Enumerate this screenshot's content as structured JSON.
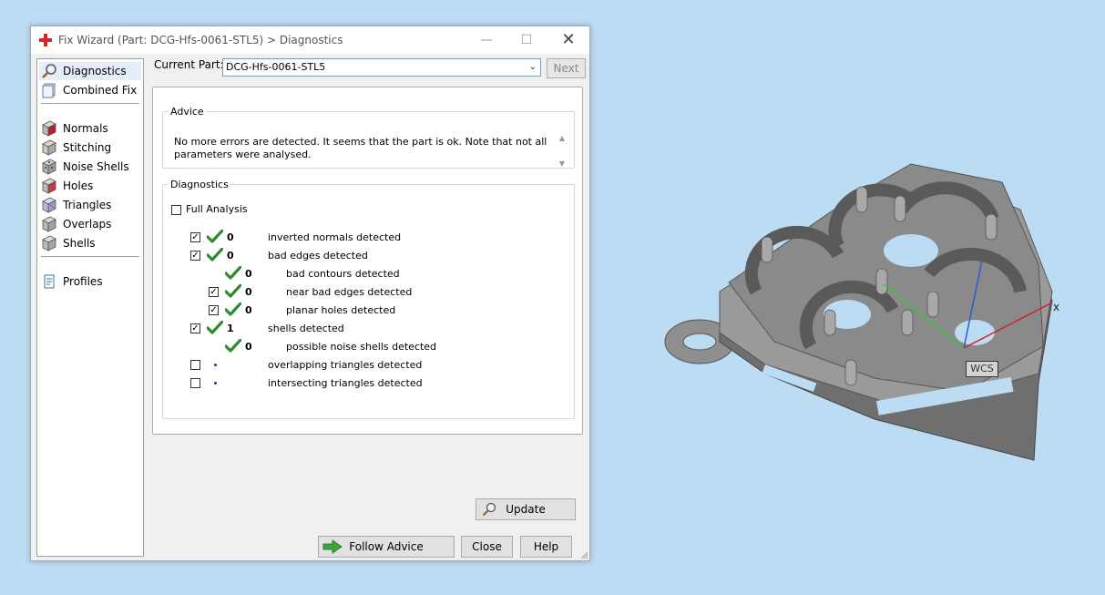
{
  "window": {
    "title": "Fix Wizard (Part: DCG-Hfs-0061-STL5) > Diagnostics",
    "minimize": "—",
    "maximize": "☐",
    "close": "✕"
  },
  "nav": {
    "items": [
      {
        "label": "Diagnostics",
        "icon": "magnifier-icon"
      },
      {
        "label": "Combined Fix",
        "icon": "combined-fix-icon"
      },
      {
        "label": "Normals",
        "icon": "normals-cube-icon"
      },
      {
        "label": "Stitching",
        "icon": "stitching-cube-icon"
      },
      {
        "label": "Noise Shells",
        "icon": "noise-shells-cube-icon"
      },
      {
        "label": "Holes",
        "icon": "holes-cube-icon"
      },
      {
        "label": "Triangles",
        "icon": "triangles-cube-icon"
      },
      {
        "label": "Overlaps",
        "icon": "overlaps-cube-icon"
      },
      {
        "label": "Shells",
        "icon": "shells-cube-icon"
      },
      {
        "label": "Profiles",
        "icon": "profiles-document-icon"
      }
    ],
    "selected": "Diagnostics"
  },
  "current_part": {
    "label": "Current Part:",
    "value": "DCG-Hfs-0061-STL5"
  },
  "next_button": "Next",
  "advice": {
    "legend": "Advice",
    "text": "No more errors are detected. It seems that the part is ok. Note that not all parameters were analysed."
  },
  "diagnostics": {
    "legend": "Diagnostics",
    "full_analysis_label": "Full Analysis",
    "full_analysis_checked": false,
    "rows": [
      {
        "checked": true,
        "status": "ok",
        "count": "0",
        "label": "inverted normals detected"
      },
      {
        "checked": true,
        "status": "ok",
        "count": "0",
        "label": "bad edges detected"
      },
      {
        "checked": null,
        "status": "ok",
        "count": "0",
        "label": "bad contours detected"
      },
      {
        "checked": true,
        "status": "ok",
        "count": "0",
        "label": "near bad edges detected"
      },
      {
        "checked": true,
        "status": "ok",
        "count": "0",
        "label": "planar holes detected"
      },
      {
        "checked": true,
        "status": "ok",
        "count": "1",
        "label": "shells detected"
      },
      {
        "checked": null,
        "status": "ok",
        "count": "0",
        "label": "possible noise shells detected"
      },
      {
        "checked": false,
        "status": "not-analysed",
        "count": "",
        "label": "overlapping triangles detected"
      },
      {
        "checked": false,
        "status": "not-analysed",
        "count": "",
        "label": "intersecting triangles detected"
      }
    ],
    "update_button": "Update"
  },
  "footer": {
    "follow_advice": "Follow Advice",
    "close": "Close",
    "help": "Help"
  },
  "viewport": {
    "wcs_label": "WCS",
    "x_axis_label": "x"
  },
  "colors": {
    "background": "#bcdcf3",
    "tick_green": "#2e8b2e",
    "model_gray": "#8c8c8c"
  }
}
